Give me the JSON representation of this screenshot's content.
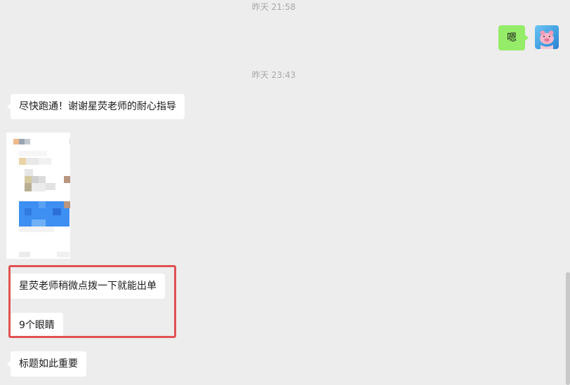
{
  "chat": {
    "timestamps": [
      "昨天 21:58",
      "昨天 23:43"
    ],
    "outgoing": [
      {
        "text": "嗯"
      }
    ],
    "incoming": [
      {
        "text": "尽快跑通！谢谢星荧老师的耐心指导"
      },
      {
        "text": "星荧老师稍微点拨一下就能出单"
      },
      {
        "text": "9个眼睛"
      },
      {
        "text": "标题如此重要"
      }
    ]
  },
  "colors": {
    "background": "#ededed",
    "incoming_bubble": "#ffffff",
    "outgoing_bubble": "#95ec69",
    "highlight_border": "#e05252",
    "timestamp_text": "#a8a8a8"
  },
  "icons": {
    "avatar": "pink-pig-avatar-icon"
  }
}
